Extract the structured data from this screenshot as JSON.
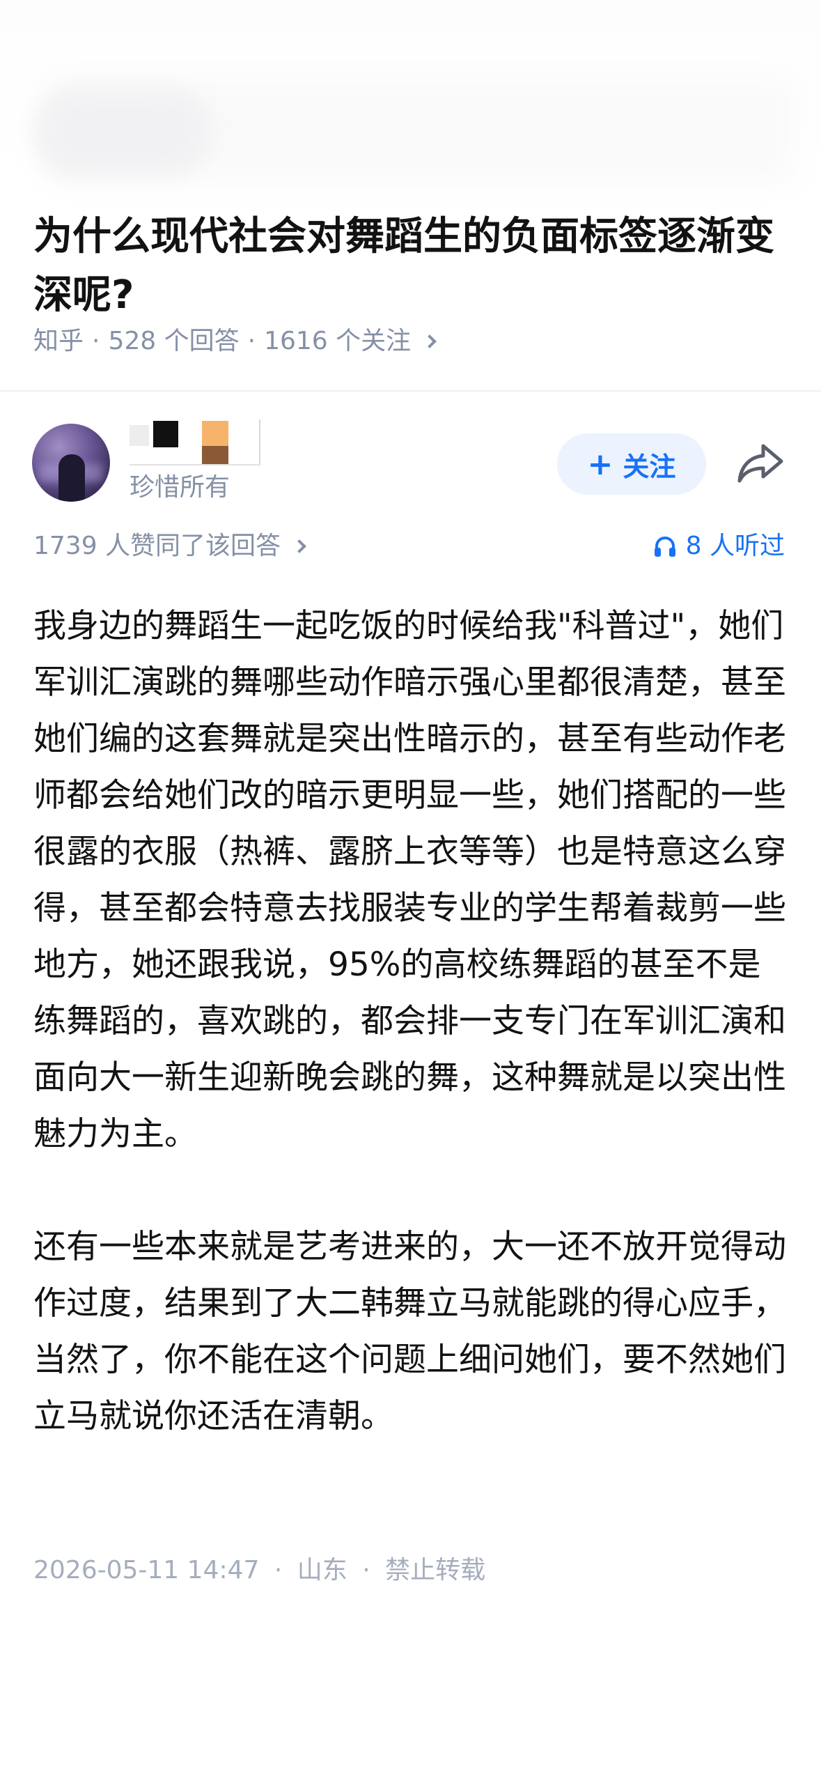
{
  "question": {
    "title": "为什么现代社会对舞蹈生的负面标签逐渐变深呢?",
    "source": "知乎",
    "answers_count": "528 个回答",
    "followers_count": "1616 个关注"
  },
  "author": {
    "name": "珍惜所有",
    "follow_label": "关注"
  },
  "stats": {
    "votes": "1739 人赞同了该回答",
    "listen": "8 人听过"
  },
  "answer": {
    "paragraphs": [
      "我身边的舞蹈生一起吃饭的时候给我\"科普过\"，她们军训汇演跳的舞哪些动作暗示强心里都很清楚，甚至她们编的这套舞就是突出性暗示的，甚至有些动作老师都会给她们改的暗示更明显一些，她们搭配的一些很露的衣服（热裤、露脐上衣等等）也是特意这么穿得，甚至都会特意去找服装专业的学生帮着裁剪一些地方，她还跟我说，95%的高校练舞蹈的甚至不是练舞蹈的，喜欢跳的，都会排一支专门在军训汇演和面向大一新生迎新晚会跳的舞，这种舞就是以突出性魅力为主。",
      "还有一些本来就是艺考进来的，大一还不放开觉得动作过度，结果到了大二韩舞立马就能跳的得心应手，当然了，你不能在这个问题上细问她们，要不然她们立马就说你还活在清朝。"
    ]
  },
  "footer": {
    "datetime": "2026-05-11 14:47",
    "location": "山东",
    "copyright": "禁止转载"
  },
  "icons": {
    "chevron": "chevron-right-icon",
    "headphones": "headphones-icon",
    "share": "share-icon",
    "plus": "plus-icon"
  },
  "colors": {
    "accent": "#1772f6",
    "follow_bg": "#ecf3ff",
    "meta_gray": "#8590a6",
    "footer_gray": "#a5adbd"
  }
}
